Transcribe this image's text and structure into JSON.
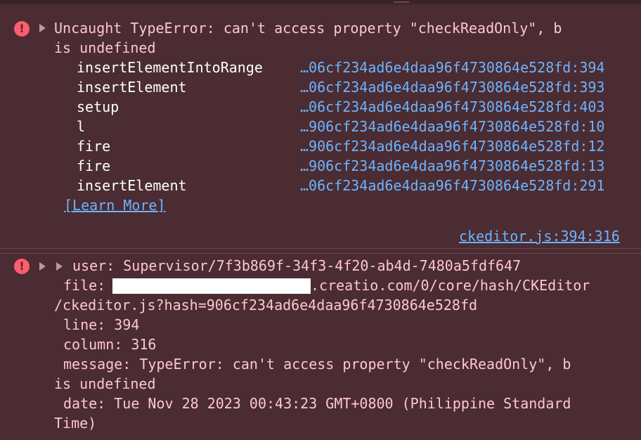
{
  "error1": {
    "message_line1": "Uncaught TypeError: can't access property \"checkReadOnly\", b",
    "message_line2": "is undefined",
    "stack": [
      {
        "fn": "insertElementIntoRange",
        "loc": "…06cf234ad6e4daa96f4730864e528fd:394"
      },
      {
        "fn": "insertElement",
        "loc": "…06cf234ad6e4daa96f4730864e528fd:393"
      },
      {
        "fn": "setup",
        "loc": "…06cf234ad6e4daa96f4730864e528fd:403"
      },
      {
        "fn": "l",
        "loc": "…906cf234ad6e4daa96f4730864e528fd:10"
      },
      {
        "fn": "fire",
        "loc": "…906cf234ad6e4daa96f4730864e528fd:12"
      },
      {
        "fn": "fire",
        "loc": "…906cf234ad6e4daa96f4730864e528fd:13"
      },
      {
        "fn": "insertElement",
        "loc": "…06cf234ad6e4daa96f4730864e528fd:291"
      }
    ],
    "learn_more": "[Learn More]",
    "source": "ckeditor.js:394:316"
  },
  "error2": {
    "user_line": "user: Supervisor/7f3b869f-34f3-4f20-ab4d-7480a5fdf647",
    "file_label": "file:",
    "file_rest": ".creatio.com/0/core/hash/CKEditor",
    "file_line2": "/ckeditor.js?hash=906cf234ad6e4daa96f4730864e528fd",
    "line": "line: 394",
    "column": "column: 316",
    "message_line1": "message: TypeError: can't access property \"checkReadOnly\", b",
    "message_line2": "is undefined",
    "date_line1": "date: Tue Nov 28 2023 00:43:23 GMT+0800 (Philippine Standard",
    "date_line2": "Time)"
  },
  "icons": {
    "error": "error-icon",
    "expand": "disclosure-triangle-icon"
  },
  "colors": {
    "background": "#4a2c32",
    "text": "#ffc6d0",
    "function_name": "#ffffff",
    "link": "#6fb3ff",
    "error_icon": "#ff5d6f"
  }
}
